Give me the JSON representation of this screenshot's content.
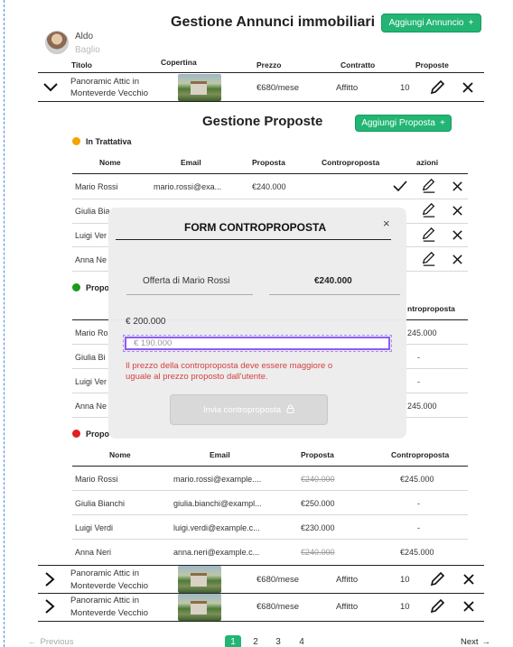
{
  "user": {
    "name": "Aldo",
    "surname": "Baglio"
  },
  "header": {
    "title": "Gestione Annunci immobiliari",
    "add_button": "Aggiungi Annuncio"
  },
  "listings_table": {
    "columns": [
      "Titolo",
      "Copertina",
      "Prezzo",
      "Contratto",
      "Proposte"
    ],
    "rows": [
      {
        "title_line1": "Panoramic Attic in",
        "title_line2": "Monteverde Vecchio",
        "price": "€680/mese",
        "contract": "Affitto",
        "proposals": "10"
      },
      {
        "title_line1": "Panoramic Attic in",
        "title_line2": "Monteverde Vecchio",
        "price": "€680/mese",
        "contract": "Affitto",
        "proposals": "10"
      },
      {
        "title_line1": "Panoramic Attic in",
        "title_line2": "Monteverde Vecchio",
        "price": "€680/mese",
        "contract": "Affitto",
        "proposals": "10"
      }
    ]
  },
  "proposals": {
    "title": "Gestione Proposte",
    "add_button": "Aggiungi Proposta",
    "sections": [
      {
        "status": "In Trattativa",
        "color": "#f5a300",
        "columns": [
          "Nome",
          "Email",
          "Proposta",
          "Controproposta",
          "azioni"
        ],
        "rows": [
          {
            "name": "Mario Rossi",
            "email": "mario.rossi@exa...",
            "offer": "€240.000",
            "counter": ""
          },
          {
            "name": "Giulia Bia",
            "email": "",
            "offer": "",
            "counter": ""
          },
          {
            "name": "Luigi Ver",
            "email": "",
            "offer": "",
            "counter": ""
          },
          {
            "name": "Anna Ne",
            "email": "",
            "offer": "",
            "counter": ""
          }
        ]
      },
      {
        "status": "Propo",
        "color": "#1a9a1a",
        "columns": [
          "",
          "",
          "",
          "ntroproposta"
        ],
        "rows": [
          {
            "name": "Mario Ro",
            "counter": "245.000"
          },
          {
            "name": "Giulia Bi",
            "counter": "-"
          },
          {
            "name": "Luigi Ver",
            "counter": "-"
          },
          {
            "name": "Anna Ne",
            "counter": "245.000"
          }
        ]
      },
      {
        "status": "Propo",
        "color": "#e02020",
        "columns": [
          "Nome",
          "Email",
          "Proposta",
          "Controproposta"
        ],
        "rows": [
          {
            "name": "Mario Rossi",
            "email": "mario.rossi@example....",
            "offer": "€240.000",
            "counter": "€245.000"
          },
          {
            "name": "Giulia Bianchi",
            "email": "giulia.bianchi@exampl...",
            "offer": "€250.000",
            "counter": "-"
          },
          {
            "name": "Luigi Verdi",
            "email": "luigi.verdi@example.c...",
            "offer": "€230.000",
            "counter": "-"
          },
          {
            "name": "Anna Neri",
            "email": "anna.neri@example.c...",
            "offer": "€240.000",
            "counter": "€245.000"
          }
        ]
      }
    ]
  },
  "modal": {
    "title": "FORM CONTROPROPOSTA",
    "offer_label": "Offerta di Mario Rossi",
    "offer_value": "€240.000",
    "counter_label": "€ 200.000",
    "input_value": "€ 190.000",
    "error": "Il prezzo della controproposta deve essere maggiore o uguale al prezzo proposto dall'utente.",
    "submit_label": "Invia controproposta"
  },
  "pagination": {
    "previous": "Previous",
    "next": "Next",
    "pages": [
      "1",
      "2",
      "3",
      "4"
    ],
    "current": "1"
  },
  "colors": {
    "accent": "#22b573",
    "error": "#d64040",
    "focus": "#8b5cf6"
  }
}
